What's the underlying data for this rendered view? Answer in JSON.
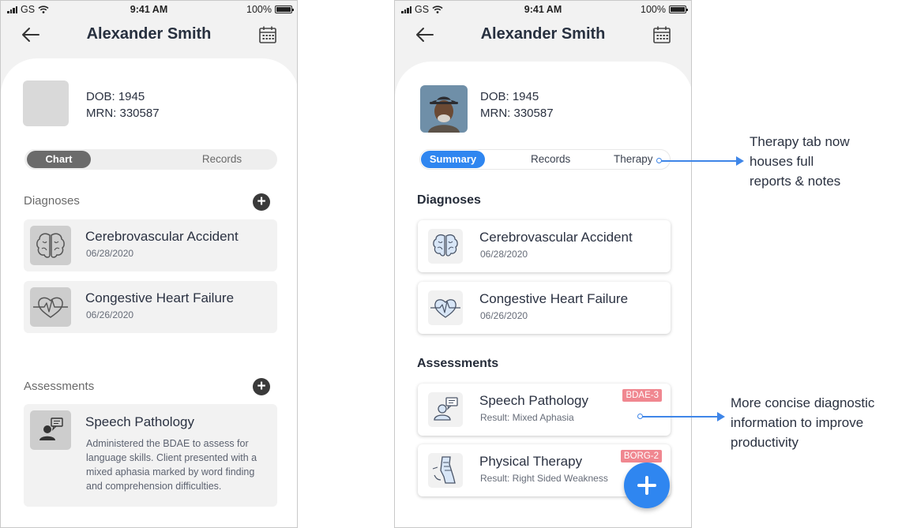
{
  "status_bar": {
    "carrier": "GS",
    "time": "9:41 AM",
    "battery": "100%"
  },
  "before": {
    "header": {
      "title": "Alexander Smith"
    },
    "patient": {
      "dob": "DOB: 1945",
      "mrn": "MRN: 330587"
    },
    "tabs": [
      {
        "label": "Chart",
        "active": true
      },
      {
        "label": "Records",
        "active": false
      }
    ],
    "diagnoses": {
      "heading": "Diagnoses",
      "items": [
        {
          "name": "Cerebrovascular Accident",
          "date": "06/28/2020",
          "icon": "brain-icon"
        },
        {
          "name": "Congestive Heart Failure",
          "date": "06/26/2020",
          "icon": "heart-icon"
        }
      ]
    },
    "assessments": {
      "heading": "Assessments",
      "items": [
        {
          "name": "Speech Pathology",
          "icon": "speech-icon",
          "description": "Administered the BDAE to assess for language skills. Client presented with a mixed aphasia marked by word finding and comprehension difficulties."
        }
      ]
    }
  },
  "after": {
    "header": {
      "title": "Alexander Smith"
    },
    "patient": {
      "dob": "DOB: 1945",
      "mrn": "MRN: 330587"
    },
    "tabs": [
      {
        "label": "Summary",
        "active": true
      },
      {
        "label": "Records",
        "active": false
      },
      {
        "label": "Therapy",
        "active": false
      }
    ],
    "diagnoses": {
      "heading": "Diagnoses",
      "items": [
        {
          "name": "Cerebrovascular Accident",
          "date": "06/28/2020",
          "icon": "brain-icon"
        },
        {
          "name": "Congestive Heart Failure",
          "date": "06/26/2020",
          "icon": "heart-icon"
        }
      ]
    },
    "assessments": {
      "heading": "Assessments",
      "items": [
        {
          "name": "Speech Pathology",
          "result": "Result: Mixed Aphasia",
          "badge": "BDAE-3",
          "icon": "speech-icon"
        },
        {
          "name": "Physical Therapy",
          "result": "Result: Right Sided Weakness",
          "badge": "BORG-2",
          "icon": "physical-therapy-icon"
        }
      ]
    }
  },
  "annotations": {
    "therapy_tab": [
      "Therapy tab now",
      "houses full",
      "reports & notes"
    ],
    "concise_info": [
      "More concise diagnostic",
      "information to improve",
      "productivity"
    ]
  },
  "colors": {
    "accent": "#2f86f0",
    "badge": "#f08790",
    "arrow": "#3f86e8"
  }
}
